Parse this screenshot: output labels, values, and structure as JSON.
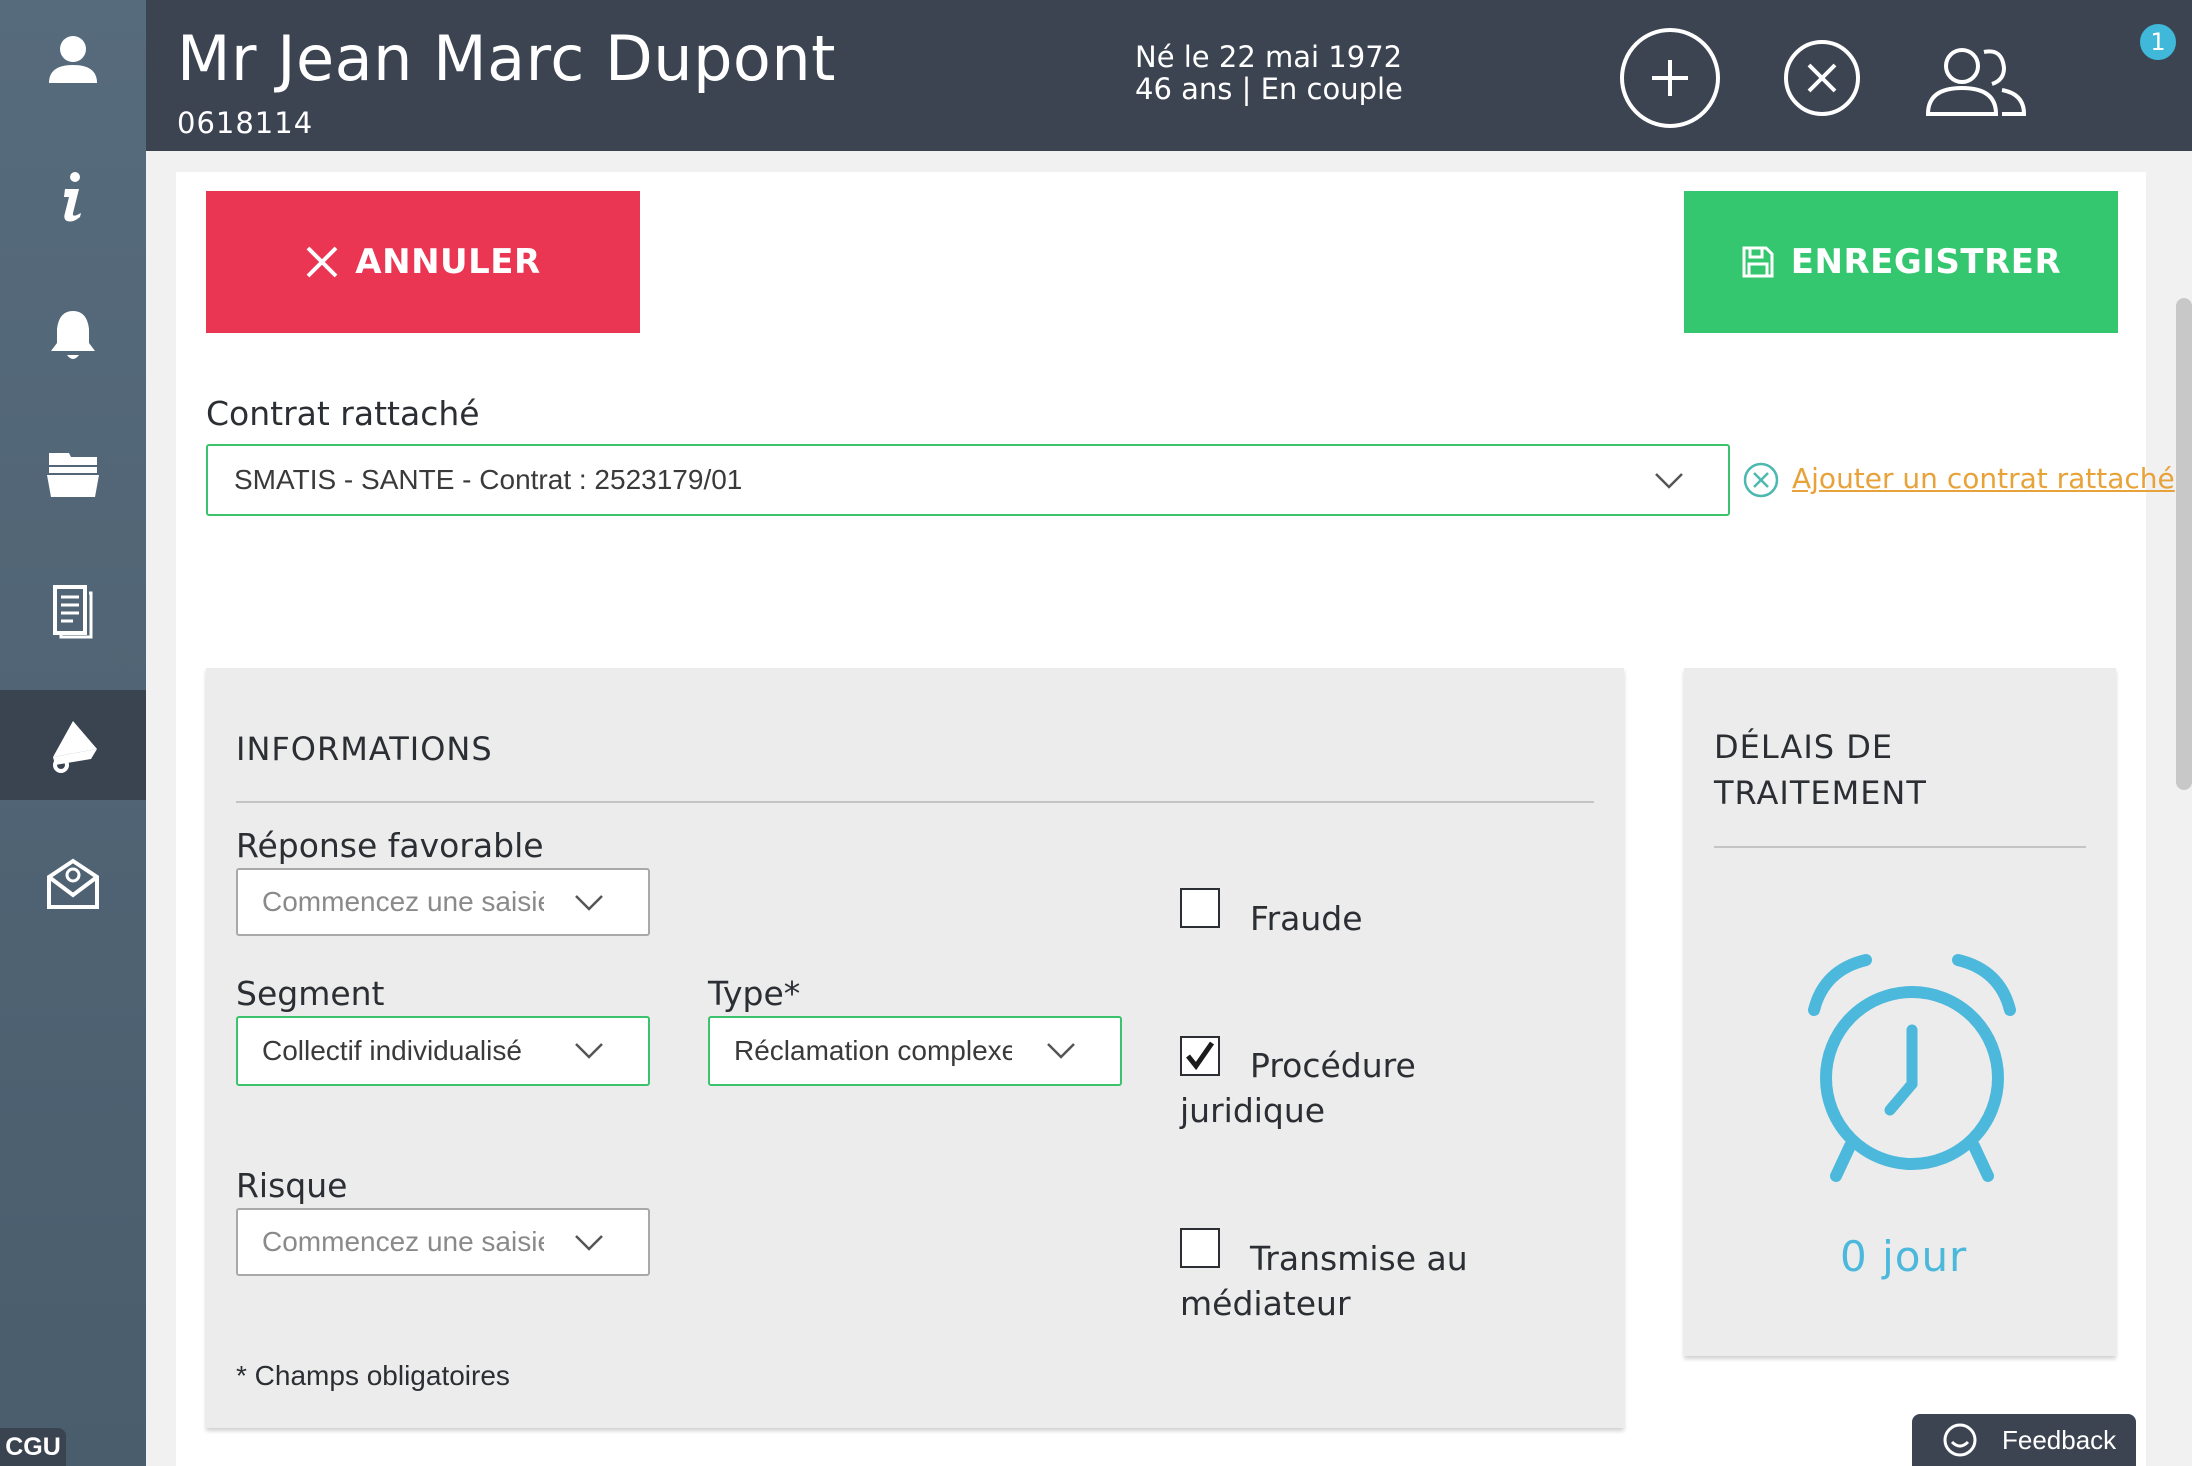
{
  "sidebar": {
    "items": [
      {
        "icon": "user-icon"
      },
      {
        "icon": "info-icon"
      },
      {
        "icon": "bell-icon"
      },
      {
        "icon": "folders-icon"
      },
      {
        "icon": "document-icon"
      },
      {
        "icon": "megaphone-icon",
        "active": true
      },
      {
        "icon": "mail-icon"
      }
    ],
    "cgu_label": "CGU"
  },
  "header": {
    "name": "Mr Jean Marc Dupont",
    "client_id": "0618114",
    "birth": "Né le 22 mai 1972",
    "status": "46 ans | En couple",
    "notification_count": "1"
  },
  "actions": {
    "cancel_label": "ANNULER",
    "save_label": "ENREGISTRER"
  },
  "contract": {
    "label": "Contrat rattaché",
    "value": "SMATIS - SANTE - Contrat : 2523179/01",
    "add_link": "Ajouter un contrat rattaché"
  },
  "informations": {
    "title": "INFORMATIONS",
    "reponse_label": "Réponse favorable",
    "reponse_placeholder": "Commencez une saisie",
    "segment_label": "Segment",
    "segment_value": "Collectif individualisé",
    "type_label": "Type*",
    "type_value": "Réclamation complexe",
    "risque_label": "Risque",
    "risque_placeholder": "Commencez une saisie",
    "checkboxes": [
      {
        "label": "Fraude",
        "checked": false
      },
      {
        "label": "Procédure juridique",
        "checked": true
      },
      {
        "label": "Transmise au médiateur",
        "checked": false
      }
    ],
    "required_note": "* Champs obligatoires"
  },
  "delais": {
    "title_line1": "DÉLAIS DE",
    "title_line2": "TRAITEMENT",
    "days": "0 jour"
  },
  "feedback_label": "Feedback",
  "colors": {
    "header_bg": "#3c4452",
    "sidebar_bg": "#4f6375",
    "cancel": "#ea3553",
    "save": "#34c76f",
    "accent_green": "#3cc26d",
    "link_orange": "#e8a23a",
    "clock_blue": "#4cb8dc"
  }
}
